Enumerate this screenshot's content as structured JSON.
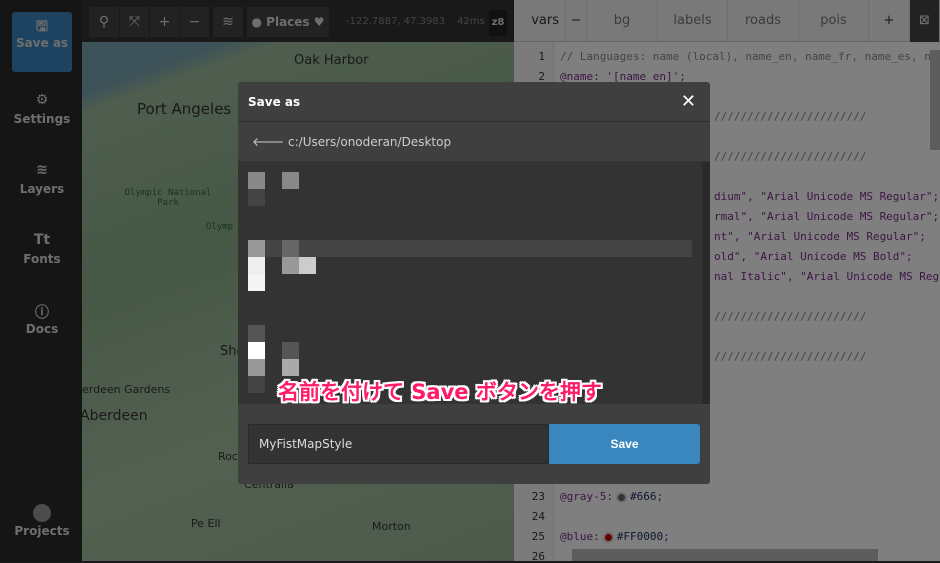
{
  "sidebar": {
    "items": [
      {
        "label": "Save as",
        "icon": "save-icon"
      },
      {
        "label": "Settings",
        "icon": "gear-icon"
      },
      {
        "label": "Layers",
        "icon": "layers-icon"
      },
      {
        "label": "Fonts",
        "icon": "fonts-icon",
        "glyph": "Tt"
      },
      {
        "label": "Docs",
        "icon": "info-icon"
      },
      {
        "label": "Projects",
        "icon": "avatar-icon"
      }
    ]
  },
  "toolbar": {
    "places": "Places",
    "coords": "-122.7887, 47.3983",
    "timing": "42ms",
    "zoom": "z8"
  },
  "map": {
    "labels": [
      "Oak Harbor",
      "Port Angeles",
      "Olympic National Park",
      "Olymp",
      "She",
      "erdeen Gardens",
      "Aberdeen",
      "Roc",
      "Centralia",
      "Pe Ell",
      "Morton"
    ]
  },
  "editor": {
    "tabs": [
      "vars",
      "bg",
      "labels",
      "roads",
      "pois"
    ],
    "minus": "−",
    "plus": "+",
    "lines": [
      {
        "n": "1",
        "text": "// Languages: name (local), name_en, name_fr, name_es, na"
      },
      {
        "n": "2",
        "text": "@name: '[name_en]';"
      },
      {
        "n": "23",
        "text": "@gray-5:",
        "value": "#666",
        "color": "#666666"
      },
      {
        "n": "24",
        "text": ""
      },
      {
        "n": "25",
        "text": "@blue:",
        "value": "#FF0000",
        "color": "#cc0000"
      },
      {
        "n": "26",
        "text": ""
      }
    ],
    "fragments": [
      "///////////////////////",
      "///////////////////////",
      "dium\", \"Arial Unicode MS Regular\";",
      "rmal\", \"Arial Unicode MS Regular\";",
      "nt\", \"Arial Unicode MS Regular\";",
      "old\", \"Arial Unicode MS Bold\";",
      "nal Italic\", \"Arial Unicode MS Reg",
      "///////////////////////",
      "///////////////////////"
    ]
  },
  "dialog": {
    "title": "Save as",
    "close": "✕",
    "path": "c:/Users/onoderan/Desktop",
    "filename": "MyFistMapStyle",
    "save_label": "Save"
  },
  "annotation": "名前を付けて Save ボタンを押す",
  "colors": {
    "accent": "#3a87c0",
    "annotation": "#ff1a6a"
  }
}
